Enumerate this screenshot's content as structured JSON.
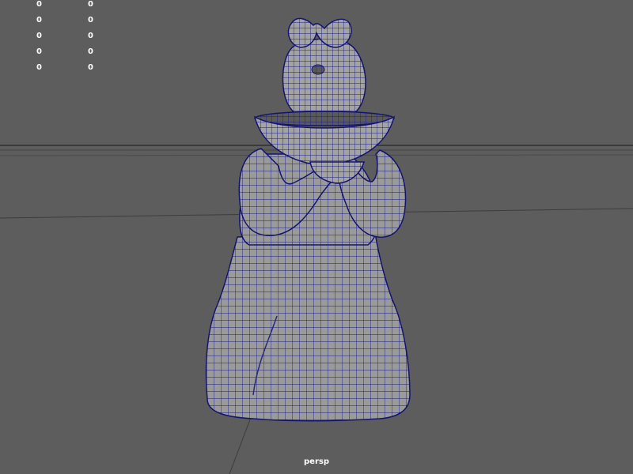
{
  "viewport": {
    "camera_label": "persp",
    "background_color": "#5d5d5d",
    "wireframe_color": "#1a1a8c",
    "mesh_color": "#9a9a9a",
    "grid_color": "#3c3c3c"
  },
  "hud": {
    "rows": [
      {
        "a": "0",
        "b": "0"
      },
      {
        "a": "0",
        "b": "0"
      },
      {
        "a": "0",
        "b": "0"
      },
      {
        "a": "0",
        "b": "0"
      },
      {
        "a": "0",
        "b": "0"
      }
    ]
  },
  "model": {
    "subject": "figurine holding bowl",
    "display_mode": "wireframe on shaded"
  }
}
